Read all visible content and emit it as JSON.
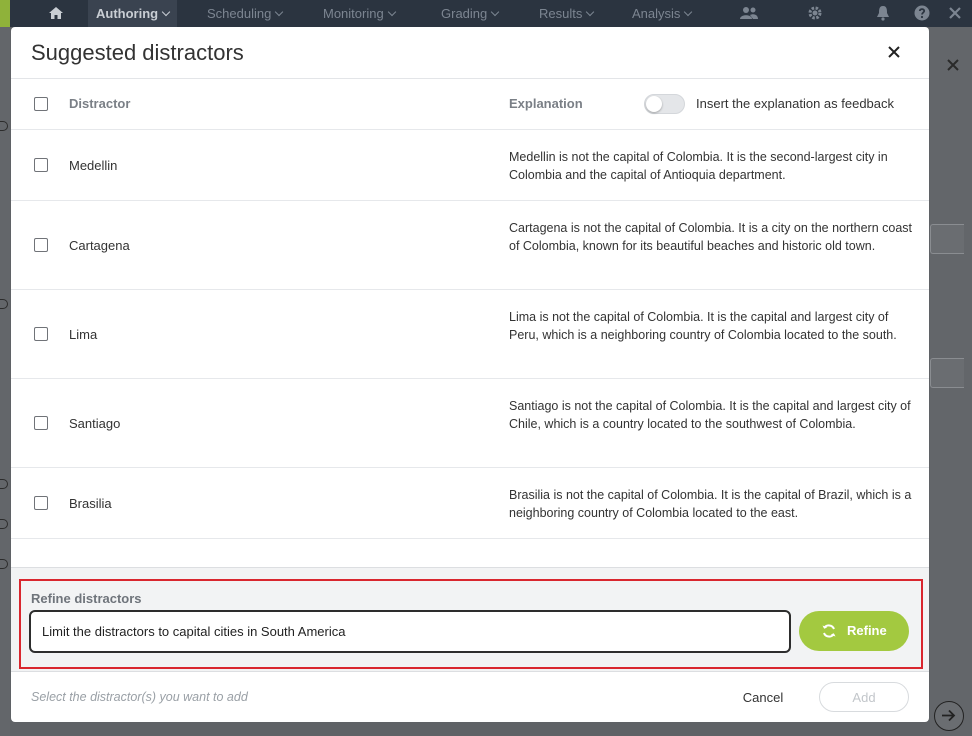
{
  "nav": {
    "items": [
      {
        "label": "Authoring",
        "active": true
      },
      {
        "label": "Scheduling",
        "active": false
      },
      {
        "label": "Monitoring",
        "active": false
      },
      {
        "label": "Grading",
        "active": false
      },
      {
        "label": "Results",
        "active": false
      },
      {
        "label": "Analysis",
        "active": false
      }
    ],
    "icons": [
      "home-icon",
      "users-icon",
      "gear-icon",
      "bell-icon",
      "help-icon",
      "close-icon"
    ]
  },
  "modal": {
    "title": "Suggested distractors",
    "columns": {
      "distractor": "Distractor",
      "explanation": "Explanation"
    },
    "toggle_label": "Insert the explanation as feedback",
    "rows": [
      {
        "name": "Medellin",
        "explanation": "Medellin is not the capital of Colombia. It is the second-largest city in Colombia and the capital of Antioquia department."
      },
      {
        "name": "Cartagena",
        "explanation": "Cartagena is not the capital of Colombia. It is a city on the northern coast of Colombia, known for its beautiful beaches and historic old town."
      },
      {
        "name": "Lima",
        "explanation": "Lima is not the capital of Colombia. It is the capital and largest city of Peru, which is a neighboring country of Colombia located to the south."
      },
      {
        "name": "Santiago",
        "explanation": "Santiago is not the capital of Colombia. It is the capital and largest city of Chile, which is a country located to the southwest of Colombia."
      },
      {
        "name": "Brasilia",
        "explanation": "Brasilia is not the capital of Colombia. It is the capital of Brazil, which is a neighboring country of Colombia located to the east."
      }
    ],
    "refine": {
      "label": "Refine distractors",
      "input_value": "Limit the distractors to capital cities in South America",
      "button_label": "Refine"
    },
    "footer": {
      "hint": "Select the distractor(s) you want to add",
      "cancel_label": "Cancel",
      "add_label": "Add"
    }
  },
  "colors": {
    "accent_green": "#a3c940",
    "highlight_red": "#d9262e",
    "nav_bg": "#2b3440"
  }
}
